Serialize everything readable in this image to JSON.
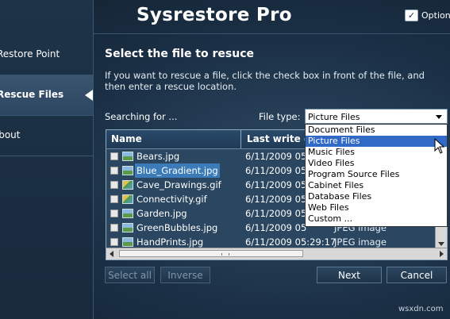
{
  "app": {
    "title": "Sysrestore Pro",
    "options_label": "Options",
    "options_icon": "check-icon"
  },
  "sidebar": {
    "items": [
      {
        "label": "Restore Point"
      },
      {
        "label": "Rescue Files",
        "active": true
      },
      {
        "label": "About"
      }
    ]
  },
  "main": {
    "heading": "Select the file to resuce",
    "description": "If you want to rescue a file, click the check box in front of the file, and then enter a rescue location.",
    "searching_label": "Searching for ...",
    "file_type_label": "File type:",
    "file_type_value": "Picture Files"
  },
  "table": {
    "columns": [
      "Name",
      "Last write d"
    ],
    "rows": [
      {
        "name": "Bears.jpg",
        "date": "6/11/2009 05",
        "type": "",
        "icon": "jpg-icon"
      },
      {
        "name": "Blue_Gradient.jpg",
        "date": "6/11/2009 05",
        "type": "",
        "icon": "jpg-icon",
        "selected": true
      },
      {
        "name": "Cave_Drawings.gif",
        "date": "6/11/2009 05",
        "type": "",
        "icon": "gif-icon"
      },
      {
        "name": "Connectivity.gif",
        "date": "6/11/2009 05",
        "type": "",
        "icon": "gif-icon"
      },
      {
        "name": "Garden.jpg",
        "date": "6/11/2009 05",
        "type": "",
        "icon": "jpg-icon"
      },
      {
        "name": "GreenBubbles.jpg",
        "date": "6/11/2009 05",
        "type": "JPEG image",
        "icon": "jpg-icon"
      },
      {
        "name": "HandPrints.jpg",
        "date": "6/11/2009 05:29:17",
        "type": "JPEG image",
        "icon": "jpg-icon"
      }
    ]
  },
  "dropdown": {
    "options": [
      "Document Files",
      "Picture Files",
      "Music Files",
      "Video Files",
      "Program Source Files",
      "Cabinet Files",
      "Database Files",
      "Web Files",
      "Custom ..."
    ],
    "highlighted_index": 1
  },
  "buttons": {
    "select_all": "Select all",
    "inverse": "Inverse",
    "next": "Next",
    "cancel": "Cancel"
  },
  "watermark": "wsxdn.com"
}
